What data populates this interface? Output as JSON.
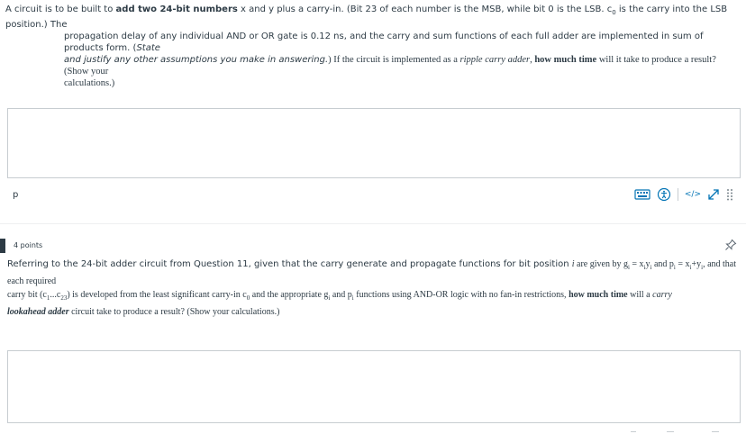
{
  "question1": {
    "line1": {
      "a": "A circuit is to be built to ",
      "b": "add two 24-bit numbers",
      "c": " x and y plus a carry-in. (Bit 23 of each number is the MSB, while bit 0 is the LSB. c",
      "c_sub": "0",
      "d": " is the carry into the LSB position.) The"
    },
    "line2": "propagation delay of any individual AND or OR gate is 0.12 ns, and the carry and sum functions of each full adder are implemented in sum of products form. (",
    "line2_italic": "State",
    "line3_italic": "and justify any other assumptions you make in answering.",
    "line3_serif_a": ") If the circuit is implemented as a ",
    "line3_serif_b": "ripple carry adder",
    "line3_serif_c": ", ",
    "line3_serif_d": "how much time",
    "line3_serif_e": " will it take to produce a result? (Show your",
    "line4": "calculations.)"
  },
  "editor": {
    "path_tag": "p",
    "tools": [
      "keyboard-icon",
      "accessibility-icon",
      "html-view-icon",
      "fullscreen-icon",
      "drag-handle-icon"
    ],
    "html_view_label": "</>"
  },
  "question2": {
    "points": "4 points",
    "l1a": "Referring to the 24-bit adder circuit from Question 11, given that the carry generate and propagate functions for bit position ",
    "l1_i": "i",
    "l1b": " are given by g",
    "l1_sub1": "i",
    "l1c": " = x",
    "l1_sub2": "i",
    "l1d": "y",
    "l1_sub3": "i",
    "l1e": " and p",
    "l1_sub4": "i",
    "l1f": " = x",
    "l1_sub5": "i",
    "l1g": "+y",
    "l1_sub6": "i",
    "l1h": ", and that each required",
    "l2a": "carry bit (c",
    "l2_sub1": "1",
    "l2b": "...c",
    "l2_sub2": "23",
    "l2c": ") is developed from the least significant carry-in c",
    "l2_sub3": "0",
    "l2d": " and the appropriate g",
    "l2_sub4": "i",
    "l2e": " and p",
    "l2_sub5": "i",
    "l2f": " functions using AND-OR logic with no fan-in restrictions, ",
    "l2g": "how much time",
    "l2h": " will a ",
    "l2i": "carry",
    "l3a": "lookahead adder",
    "l3b": " circuit take to produce a result? (Show your calculations.)"
  },
  "colors": {
    "text": "#2d3b45",
    "border": "#c7cdd1",
    "accent": "#0374b5"
  }
}
